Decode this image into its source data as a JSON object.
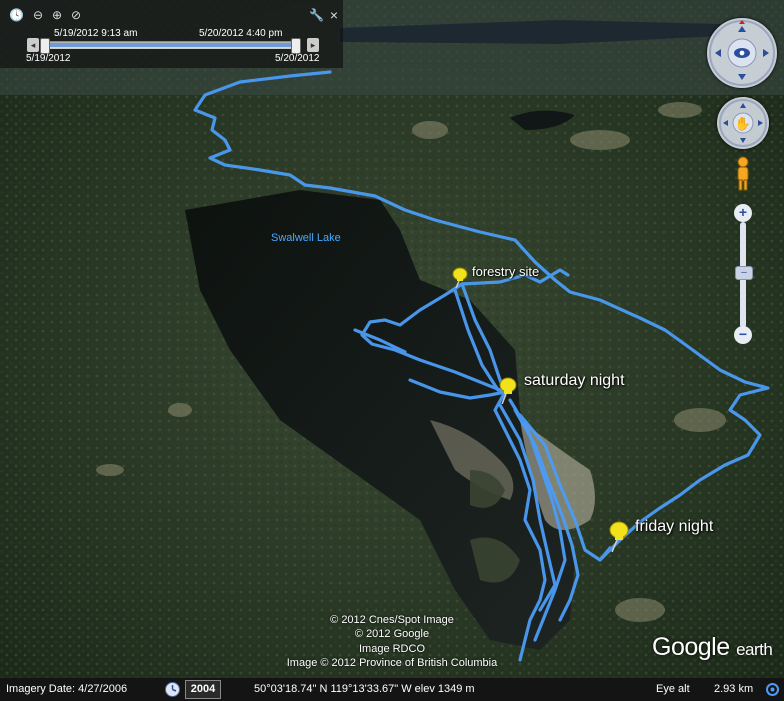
{
  "map": {
    "lake_label": "Swalwell Lake",
    "placemarks": [
      {
        "label": "forestry site"
      },
      {
        "label": "saturday night"
      },
      {
        "label": "friday night"
      }
    ],
    "track_color": "#4b9cf5"
  },
  "time_slider": {
    "range_start": "5/19/2012   9:13 am",
    "range_end": "5/20/2012   4:40 pm",
    "min_label": "5/19/2012",
    "max_label": "5/20/2012"
  },
  "attribution": [
    "© 2012 Cnes/Spot Image",
    "© 2012 Google",
    "Image RDCO",
    "Image © 2012 Province of British Columbia"
  ],
  "brand": {
    "google": "Google",
    "earth": "earth"
  },
  "status_bar": {
    "imagery_date": "Imagery Date: 4/27/2006",
    "year": "2004",
    "coords": "50°03'18.74\" N 119°13'33.67\" W  elev  1349 m",
    "eye_alt_label": "Eye alt",
    "eye_alt_value": "2.93 km"
  },
  "icons": {
    "clock": "clock-icon",
    "zoom_out": "zoom-out-icon",
    "zoom_in": "zoom-in-icon",
    "settings": "wrench-icon",
    "close": "close-icon",
    "look": "look-joystick-icon",
    "move": "move-joystick-icon",
    "streetview": "pegman-icon"
  }
}
